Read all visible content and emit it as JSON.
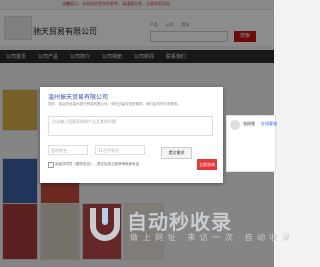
{
  "top_notice": "温馨提示：本网站信息仅供参考，请谨慎交易，注意防范风险",
  "header": {
    "company_name": "驰天贸易有限公司",
    "search_tabs": [
      "产品",
      "公司",
      "资讯"
    ],
    "search_placeholder": "",
    "search_button": "搜索"
  },
  "nav": {
    "items": [
      "公司首页",
      "公司产品",
      "公司简介",
      "公司相册",
      "公司新闻",
      "联系我们"
    ]
  },
  "modal": {
    "title": "温州振天贸易有限公司",
    "desc": "您好，欢迎光临温州振天贸易有限公司，请在此留言您的需求，我们会尽快与您联系。",
    "textarea_placeholder": "点击输入您要采购的产品及其他问题",
    "name_placeholder": "您的姓名",
    "phone_placeholder": "11位手机号",
    "submit_label": "提交需求",
    "agree_text": "阅读并同意《服务协议》，提交后将立即获得商家电话"
  },
  "contact": {
    "name": "张经理",
    "tag": "在线客服",
    "call_button": "立即咨询"
  },
  "watermark": {
    "title": "自动秒收录",
    "subtitle": "做 上 网 址 · 来 访 一 次 · 自 动 收 录"
  },
  "colors": {
    "accent": "#c51317",
    "nav_bg": "#2c2c2c",
    "modal_title": "#2c4fa0",
    "watermark": "#c9ccd0"
  }
}
